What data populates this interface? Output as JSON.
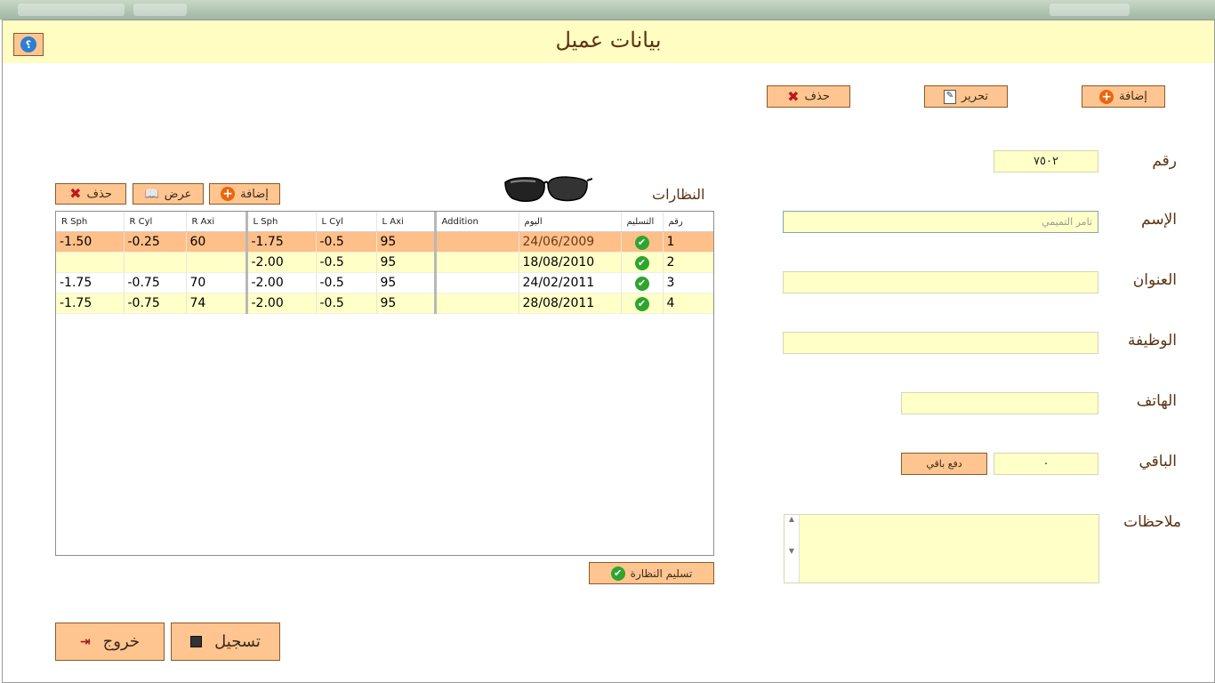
{
  "window": {
    "title": "بيانات عميل"
  },
  "top_actions": {
    "add": "إضافة",
    "edit": "تحرير",
    "delete": "حذف"
  },
  "form": {
    "number_label": "رقم",
    "number_value": "٧٥٠٢",
    "name_label": "الإسم",
    "name_value": "تامر التميمي",
    "address_label": "العنوان",
    "address_value": "",
    "job_label": "الوظيفة",
    "job_value": "",
    "phone_label": "الهاتف",
    "phone_value": "",
    "remaining_label": "الباقي",
    "remaining_value": "٠",
    "pay_remaining_button": "دفع باقي",
    "notes_label": "ملاحظات",
    "notes_value": ""
  },
  "glasses": {
    "section_title": "النظارات",
    "add": "إضافة",
    "view": "عرض",
    "delete": "حذف",
    "deliver_button": "تسليم النظارة",
    "columns": [
      "R Sph",
      "R Cyl",
      "R Axi",
      "L Sph",
      "L Cyl",
      "L Axi",
      "Addition",
      "اليوم",
      "التسليم",
      "رقم"
    ],
    "rows": [
      {
        "r_sph": "-1.50",
        "r_cyl": "-0.25",
        "r_axi": "60",
        "l_sph": "-1.75",
        "l_cyl": "-0.5",
        "l_axi": "95",
        "addition": "",
        "date": "24/06/2009",
        "delivered": true,
        "num": "1"
      },
      {
        "r_sph": "",
        "r_cyl": "",
        "r_axi": "",
        "l_sph": "-2.00",
        "l_cyl": "-0.5",
        "l_axi": "95",
        "addition": "",
        "date": "18/08/2010",
        "delivered": true,
        "num": "2"
      },
      {
        "r_sph": "-1.75",
        "r_cyl": "-0.75",
        "r_axi": "70",
        "l_sph": "-2.00",
        "l_cyl": "-0.5",
        "l_axi": "95",
        "addition": "",
        "date": "24/02/2011",
        "delivered": true,
        "num": "3"
      },
      {
        "r_sph": "-1.75",
        "r_cyl": "-0.75",
        "r_axi": "74",
        "l_sph": "-2.00",
        "l_cyl": "-0.5",
        "l_axi": "95",
        "addition": "",
        "date": "28/08/2011",
        "delivered": true,
        "num": "4"
      }
    ]
  },
  "bottom": {
    "save": "تسجيل",
    "exit": "خروج"
  },
  "colors": {
    "button_bg": "#ffc590",
    "field_bg": "#ffffc8",
    "title_bg": "#fffdc2",
    "selected_row": "#ffbf88",
    "label_text": "#5a3412"
  }
}
